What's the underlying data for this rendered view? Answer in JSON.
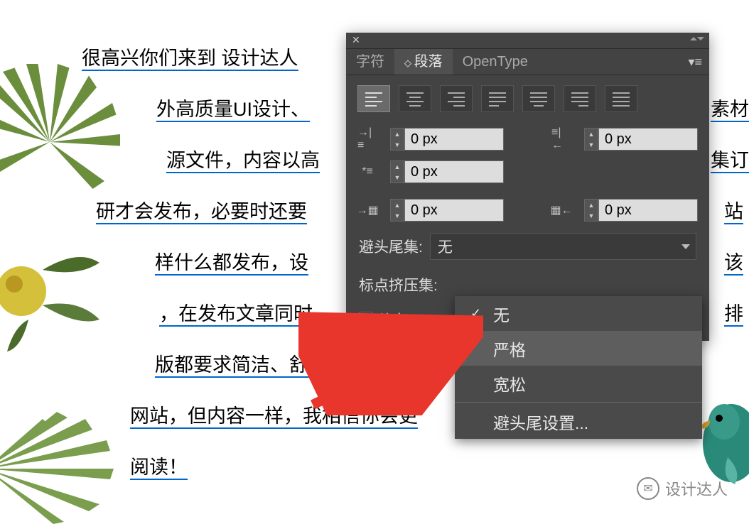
{
  "doc_lines": [
    "很高兴你们来到 设计达人",
    "外高质量UI设计、",
    "源文件，内容以高",
    "研才会发布，必要时还要",
    "样什么都发布，设",
    "，在发布文章同时",
    "版都要求简洁、舒适",
    "网站，但内容一样，我相信你会更",
    "阅读！"
  ],
  "right_lines": [
    "素材",
    "集订",
    "站",
    "该",
    "排"
  ],
  "panel": {
    "tabs": {
      "char": "字符",
      "para": "段落",
      "ot": "OpenType"
    },
    "indent_left": "0 px",
    "indent_right": "0 px",
    "first_line": "0 px",
    "space_before": "0 px",
    "space_after": "0 px",
    "kinsoku_label": "避头尾集:",
    "kinsoku_value": "无",
    "mojikumi_label": "标点挤压集:",
    "ligature": "连字"
  },
  "dd": {
    "none": "无",
    "strict": "严格",
    "loose": "宽松",
    "settings": "避头尾设置..."
  },
  "wm": "设计达人"
}
